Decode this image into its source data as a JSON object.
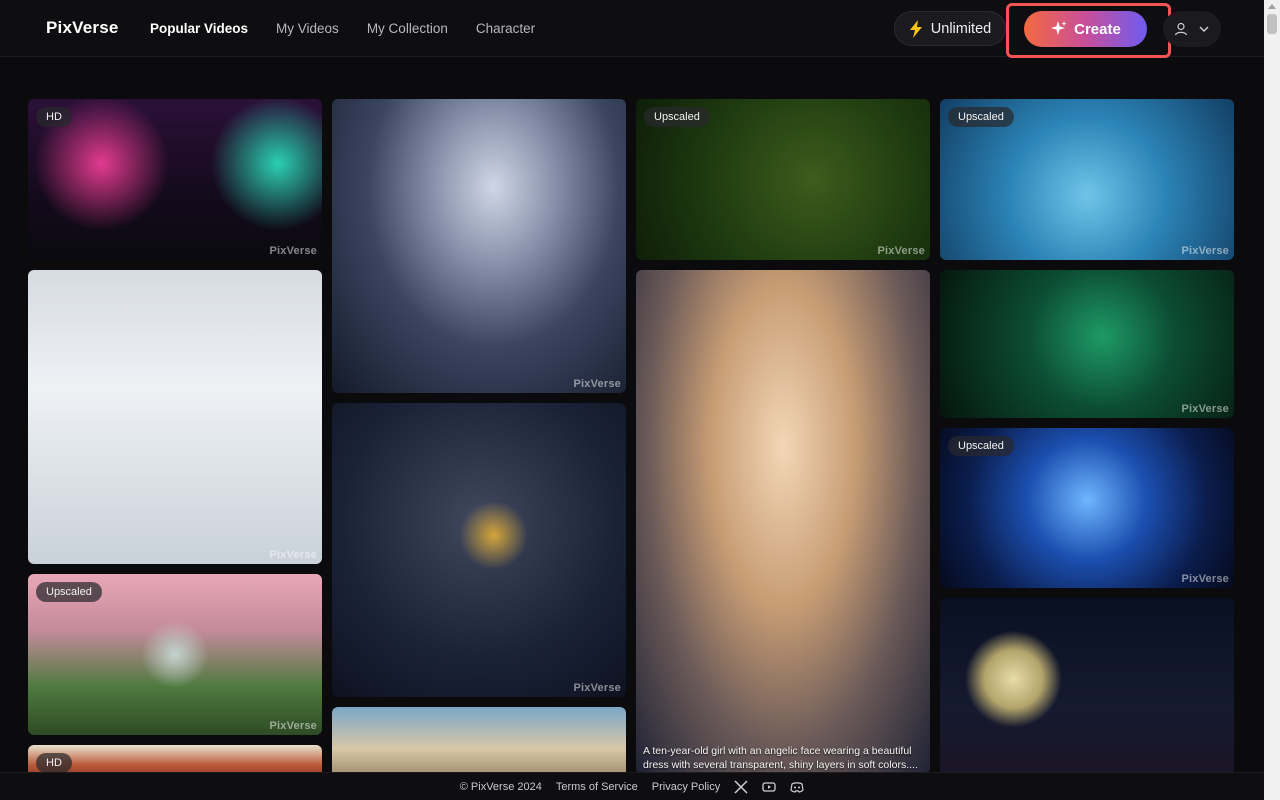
{
  "header": {
    "logo": "PixVerse",
    "nav": [
      "Popular Videos",
      "My Videos",
      "My Collection",
      "Character"
    ],
    "unlimited_label": "Unlimited",
    "create_label": "Create"
  },
  "cards": [
    {
      "badge": "HD",
      "watermark": "PixVerse"
    },
    {
      "badge": "",
      "watermark": "PixVerse"
    },
    {
      "badge": "",
      "watermark": "PixVerse"
    },
    {
      "badge": "",
      "watermark": "PixVerse"
    },
    {
      "badge": "Upscaled",
      "watermark": "PixVerse"
    },
    {
      "badge": "HD",
      "watermark": ""
    },
    {
      "badge": "Upscaled",
      "watermark": "PixVerse"
    },
    {
      "badge": "",
      "caption": "A ten-year-old girl with an angelic face wearing a beautiful dress with several transparent, shiny layers in soft colors...."
    },
    {
      "badge": "Upscaled",
      "watermark": "PixVerse"
    },
    {
      "badge": "",
      "watermark": "PixVerse"
    },
    {
      "badge": "Upscaled",
      "watermark": "PixVerse"
    },
    {
      "badge": "",
      "watermark": ""
    },
    {
      "badge": "",
      "watermark": ""
    }
  ],
  "footer": {
    "copyright": "© PixVerse 2024",
    "terms": "Terms of Service",
    "privacy": "Privacy Policy",
    "social": [
      "x-icon",
      "youtube-icon",
      "discord-icon"
    ]
  },
  "colors": {
    "accent_gradient": [
      "#f4693f",
      "#c84f9a",
      "#6e5cf0"
    ],
    "highlight": "#f05454",
    "background": "#0b0b0d"
  }
}
